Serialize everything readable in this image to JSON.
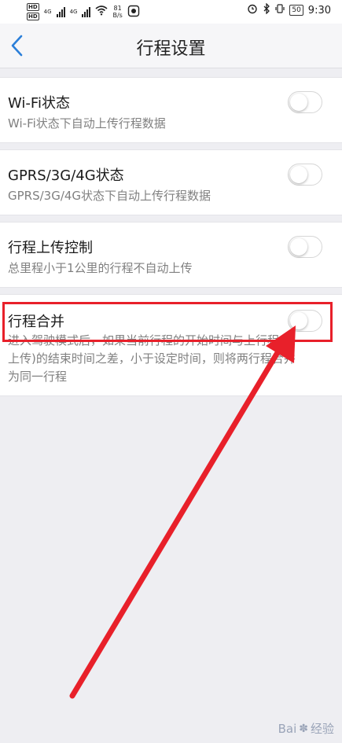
{
  "status_bar": {
    "hd_badge": "HD",
    "network_1": "4G",
    "network_2": "4G",
    "speed_value": "81",
    "speed_unit": "B/s",
    "battery": "50",
    "time": "9:30"
  },
  "header": {
    "title": "行程设置",
    "back_icon": "chevron-left-icon"
  },
  "settings": [
    {
      "title": "Wi-Fi状态",
      "desc": "Wi-Fi状态下自动上传行程数据",
      "enabled": false
    },
    {
      "title": "GPRS/3G/4G状态",
      "desc": "GPRS/3G/4G状态下自动上传行程数据",
      "enabled": false
    },
    {
      "title": "行程上传控制",
      "desc": "总里程小于1公里的行程不自动上传",
      "enabled": false
    },
    {
      "title": "行程合并",
      "desc": "进入驾驶模式后，如果当前行程的开始时间与上行程(未上传)的结束时间之差，小于设定时间，则将两行程合并为同一行程",
      "enabled": false
    }
  ],
  "watermark": {
    "brand_part1": "Bai",
    "brand_part2": "经验"
  },
  "colors": {
    "accent": "#2b7fd9",
    "annotation_red": "#e8202a",
    "background": "#eeeef2"
  }
}
